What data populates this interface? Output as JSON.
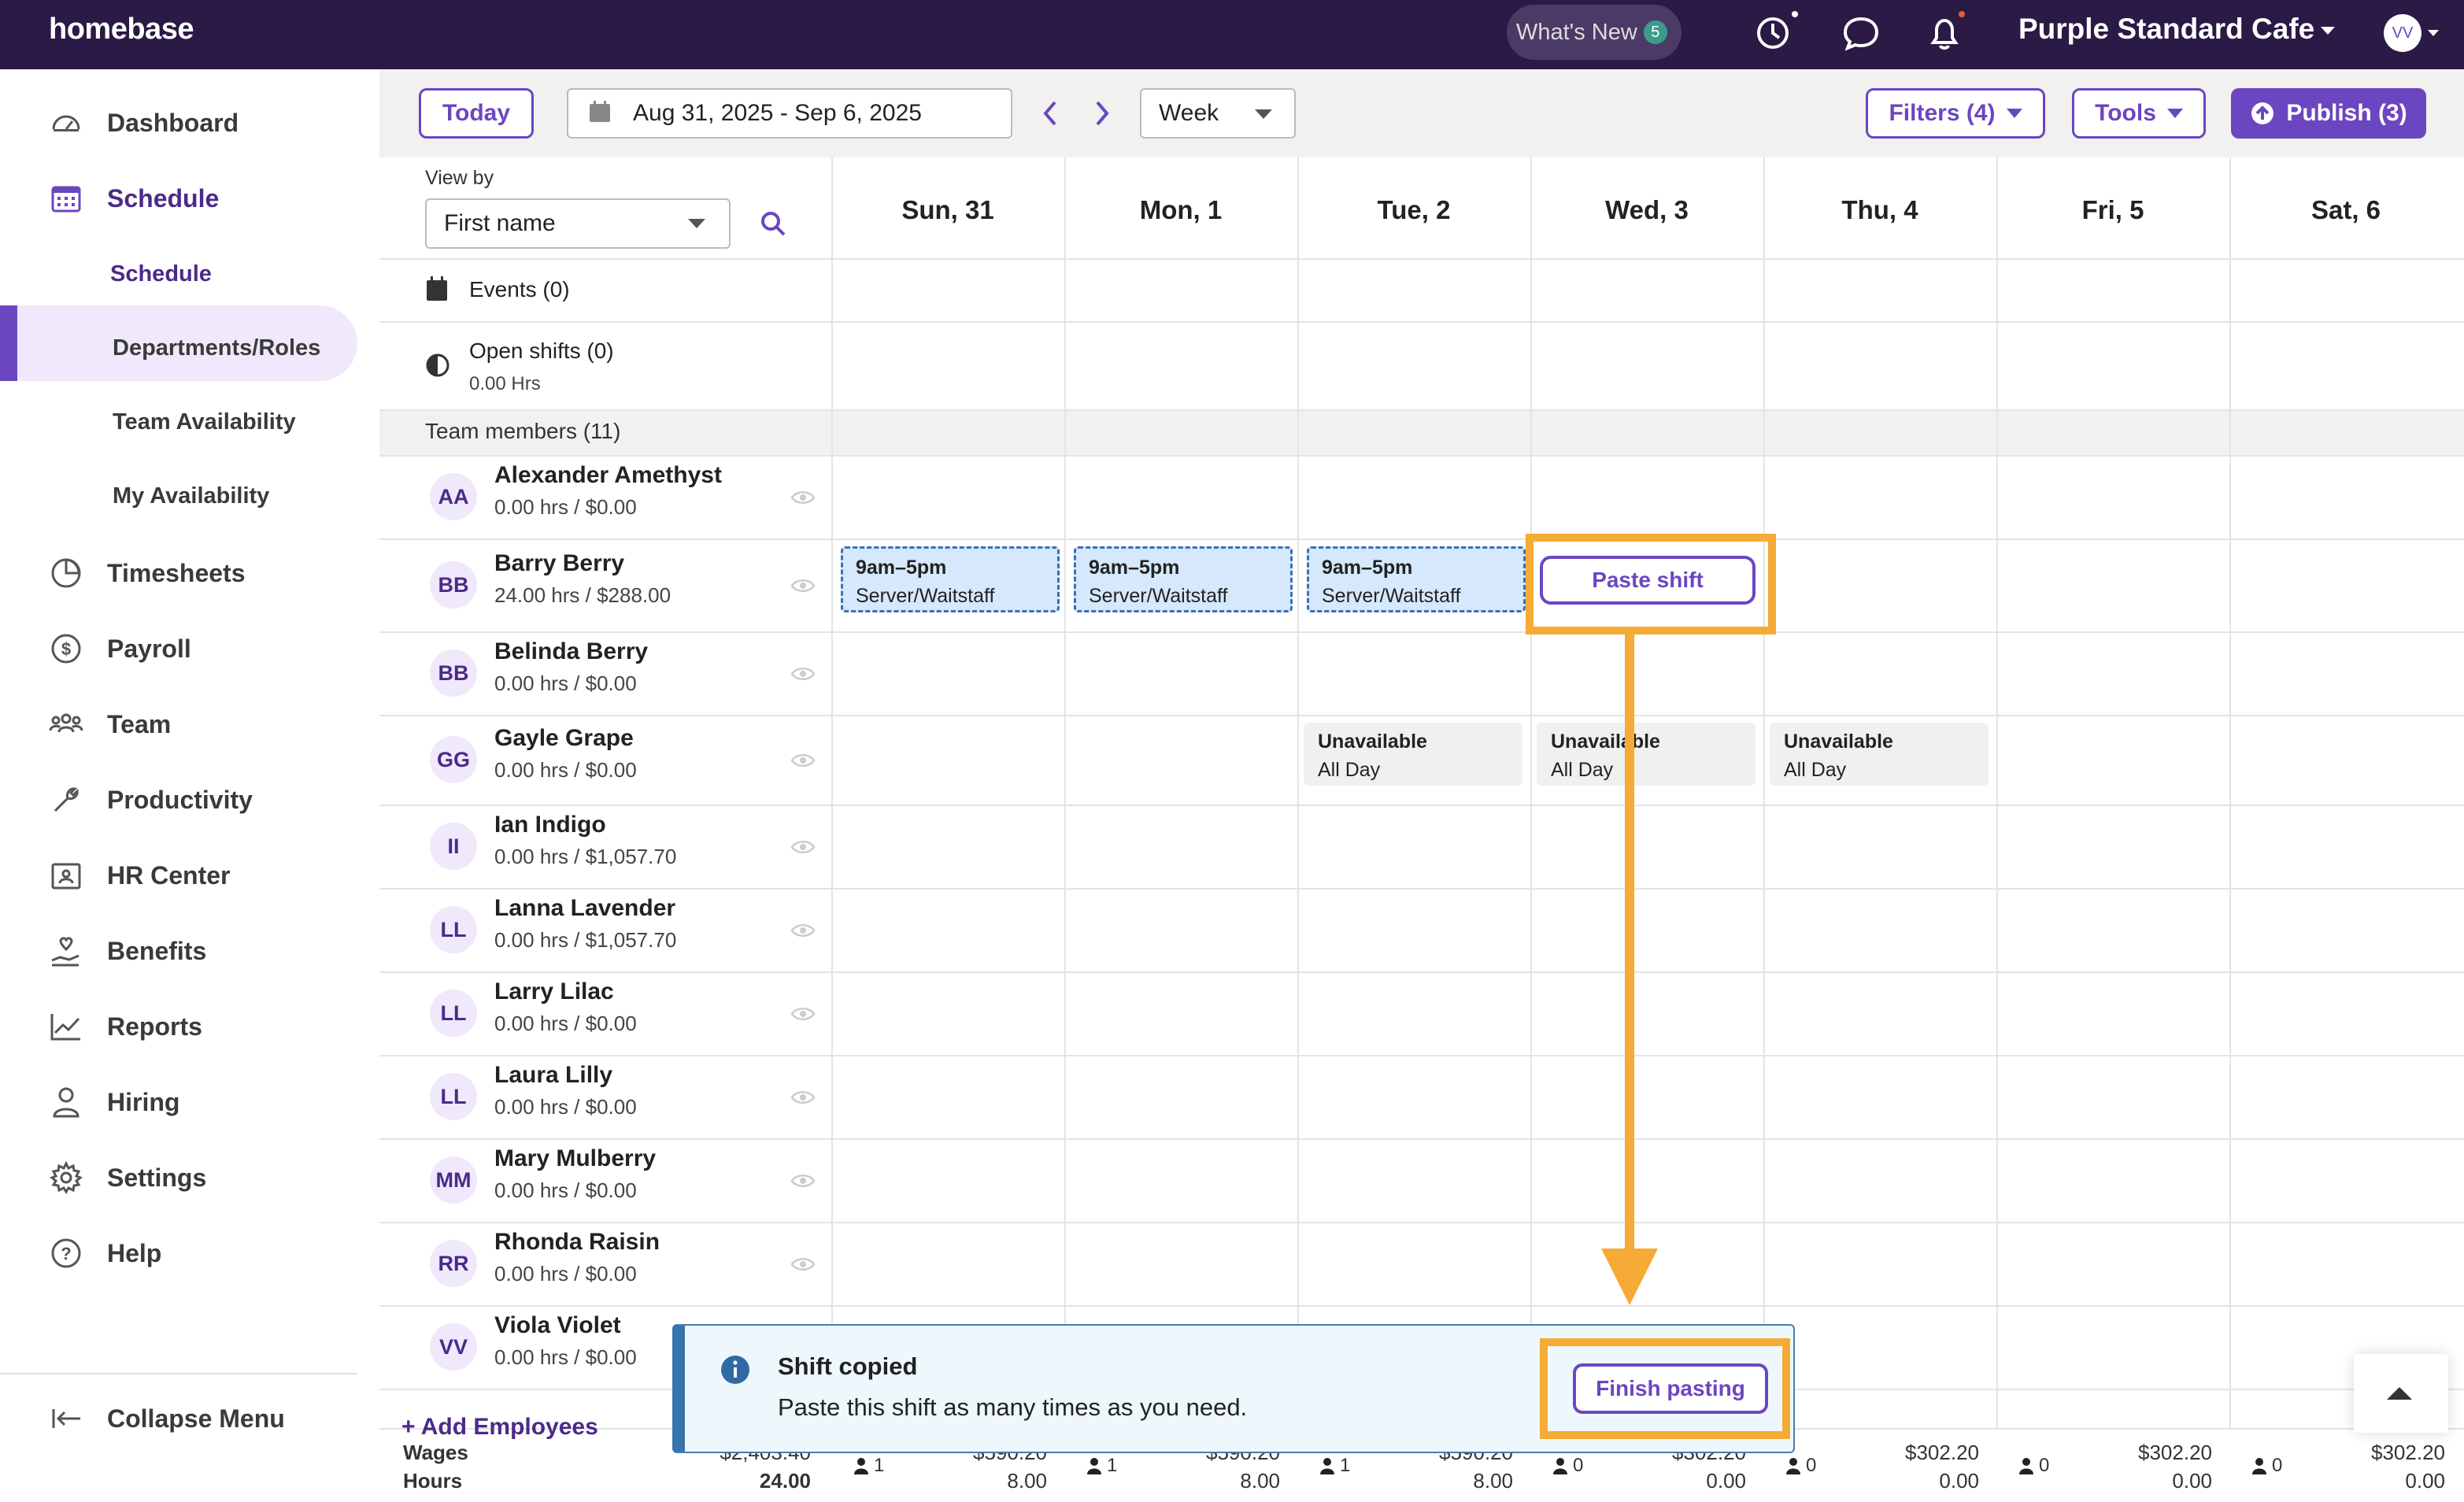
{
  "topbar": {
    "logo": "homebase",
    "whats_new": "What's New",
    "whats_new_count": "5",
    "location": "Purple Standard Cafe",
    "user_initials": "VV"
  },
  "sidebar": {
    "items": [
      {
        "label": "Dashboard",
        "icon": "dashboard-icon"
      },
      {
        "label": "Schedule",
        "icon": "calendar-icon",
        "active": true
      },
      {
        "label": "Timesheets",
        "icon": "clock-icon"
      },
      {
        "label": "Payroll",
        "icon": "dollar-icon"
      },
      {
        "label": "Team",
        "icon": "team-icon"
      },
      {
        "label": "Productivity",
        "icon": "wrench-icon"
      },
      {
        "label": "HR Center",
        "icon": "badge-icon"
      },
      {
        "label": "Benefits",
        "icon": "hand-heart-icon"
      },
      {
        "label": "Reports",
        "icon": "chart-icon"
      },
      {
        "label": "Hiring",
        "icon": "person-icon"
      },
      {
        "label": "Settings",
        "icon": "gear-icon"
      },
      {
        "label": "Help",
        "icon": "help-icon"
      }
    ],
    "sub_items": [
      "Schedule",
      "Departments/Roles",
      "Team Availability",
      "My Availability"
    ],
    "collapse": "Collapse Menu"
  },
  "toolbar": {
    "today": "Today",
    "date_range": "Aug 31, 2025 - Sep 6, 2025",
    "view": "Week",
    "filters": "Filters (4)",
    "tools": "Tools",
    "publish": "Publish (3)"
  },
  "grid": {
    "view_by_label": "View by",
    "view_by_value": "First name",
    "days": [
      "Sun, 31",
      "Mon, 1",
      "Tue, 2",
      "Wed, 3",
      "Thu, 4",
      "Fri, 5",
      "Sat, 6"
    ],
    "events": "Events (0)",
    "open_shifts": "Open shifts (0)",
    "open_shifts_hrs": "0.00 Hrs",
    "team_header": "Team members (11)",
    "add_employees": "+ Add Employees"
  },
  "employees": [
    {
      "initials": "AA",
      "name": "Alexander Amethyst",
      "summary": "0.00 hrs / $0.00"
    },
    {
      "initials": "BB",
      "name": "Barry Berry",
      "summary": "24.00 hrs / $288.00"
    },
    {
      "initials": "BB",
      "name": "Belinda Berry",
      "summary": "0.00 hrs / $0.00"
    },
    {
      "initials": "GG",
      "name": "Gayle Grape",
      "summary": "0.00 hrs / $0.00"
    },
    {
      "initials": "II",
      "name": "Ian Indigo",
      "summary": "0.00 hrs / $1,057.70"
    },
    {
      "initials": "LL",
      "name": "Lanna Lavender",
      "summary": "0.00 hrs / $1,057.70"
    },
    {
      "initials": "LL",
      "name": "Larry Lilac",
      "summary": "0.00 hrs / $0.00"
    },
    {
      "initials": "LL",
      "name": "Laura Lilly",
      "summary": "0.00 hrs / $0.00"
    },
    {
      "initials": "MM",
      "name": "Mary Mulberry",
      "summary": "0.00 hrs / $0.00"
    },
    {
      "initials": "RR",
      "name": "Rhonda Raisin",
      "summary": "0.00 hrs / $0.00"
    },
    {
      "initials": "VV",
      "name": "Viola Violet",
      "summary": "0.00 hrs / $0.00"
    }
  ],
  "shifts": [
    {
      "time": "9am–5pm",
      "role": "Server/Waitstaff"
    },
    {
      "time": "9am–5pm",
      "role": "Server/Waitstaff"
    },
    {
      "time": "9am–5pm",
      "role": "Server/Waitstaff"
    }
  ],
  "unavailable": [
    {
      "label": "Unavailable",
      "sub": "All Day"
    },
    {
      "label": "Unavailable",
      "sub": "All Day"
    },
    {
      "label": "Unavailable",
      "sub": "All Day"
    }
  ],
  "paste_shift": "Paste shift",
  "toast": {
    "title": "Shift copied",
    "message": "Paste this shift as many times as you need.",
    "action": "Finish pasting"
  },
  "footer": {
    "wages_label": "Wages",
    "hours_label": "Hours",
    "total_wages": "$2,403.40",
    "total_hours": "24.00",
    "days": [
      {
        "count": "1",
        "wages": "$590.20",
        "hours": "8.00"
      },
      {
        "count": "1",
        "wages": "$590.20",
        "hours": "8.00"
      },
      {
        "count": "1",
        "wages": "$590.20",
        "hours": "8.00"
      },
      {
        "count": "0",
        "wages": "$302.20",
        "hours": "0.00"
      },
      {
        "count": "0",
        "wages": "$302.20",
        "hours": "0.00"
      },
      {
        "count": "0",
        "wages": "$302.20",
        "hours": "0.00"
      },
      {
        "count": "0",
        "wages": "$302.20",
        "hours": "0.00"
      }
    ]
  },
  "colors": {
    "brand_purple": "#6b46c1",
    "topbar_bg": "#2a1a45",
    "highlight_orange": "#f5ab35",
    "shift_blue": "#d6e8fb"
  }
}
